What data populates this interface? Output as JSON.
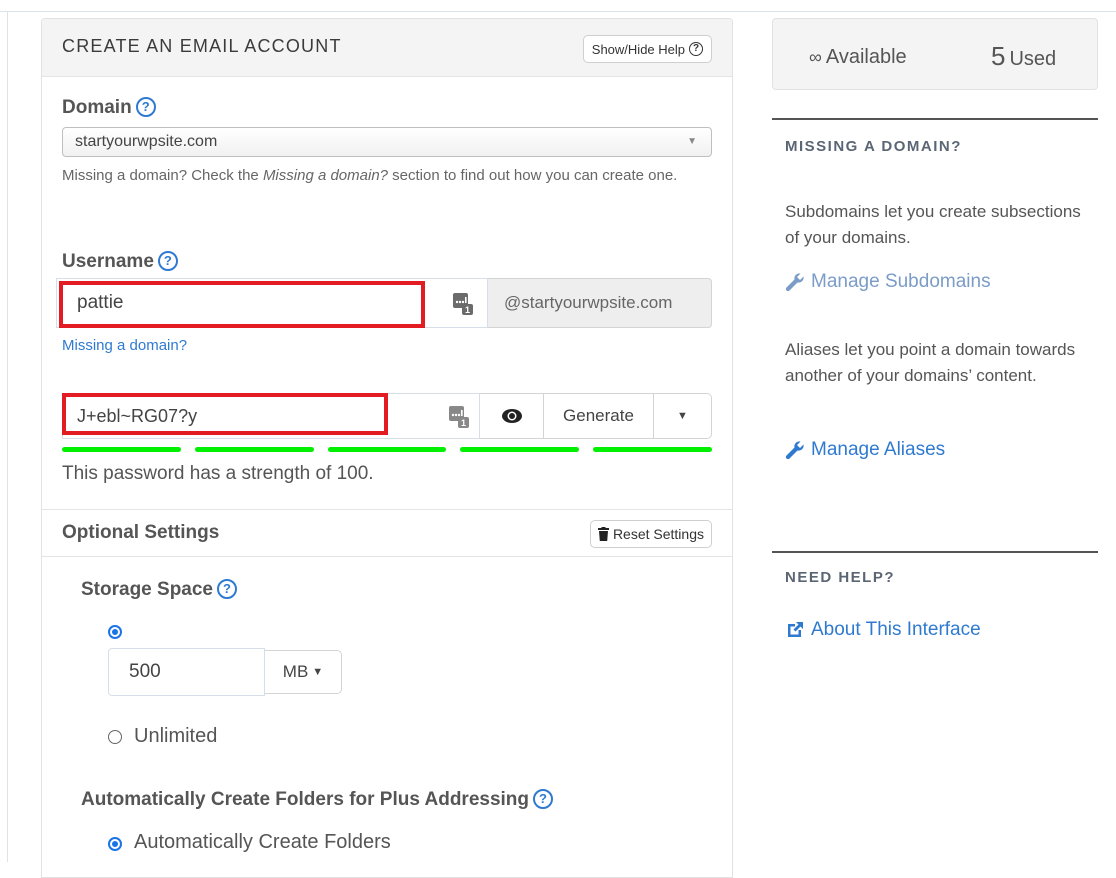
{
  "panel": {
    "title": "CREATE AN EMAIL ACCOUNT",
    "help_button": "Show/Hide Help"
  },
  "domain": {
    "label": "Domain",
    "selected": "startyourwpsite.com",
    "help_prefix": "Missing a domain? Check the ",
    "help_emphasis": "Missing a domain?",
    "help_suffix": " section to find out how you can create one."
  },
  "username": {
    "label": "Username",
    "value": "pattie",
    "suffix": "@startyourwpsite.com",
    "missing_link": "Missing a domain?"
  },
  "password": {
    "value": "J+ebl~RG07?y",
    "generate_label": "Generate",
    "strength_segments": 5,
    "strength_filled": 5,
    "strength_color": "#00f000",
    "strength_text": "This password has a strength of 100."
  },
  "optional": {
    "title": "Optional Settings",
    "reset_label": "Reset Settings",
    "storage": {
      "label": "Storage Space",
      "value": "500",
      "unit": "MB",
      "unlimited_label": "Unlimited",
      "selected": "custom"
    },
    "plus_addressing": {
      "label": "Automatically Create Folders for Plus Addressing",
      "option_label": "Automatically Create Folders",
      "selected": true
    }
  },
  "sidebar": {
    "available_symbol": "∞",
    "available_label": "Available",
    "used_count": "5",
    "used_label": "Used",
    "missing_domain": {
      "heading": "MISSING A DOMAIN?",
      "subdomains_text": "Subdomains let you create subsections of your domains.",
      "subdomains_link": "Manage Subdomains",
      "aliases_text": "Aliases let you point a domain towards another of your domains’ content.",
      "aliases_link": "Manage Aliases"
    },
    "need_help": {
      "heading": "NEED HELP?",
      "link": "About This Interface"
    }
  },
  "colors": {
    "link": "#2f7ad1",
    "link_muted": "#7a9cc6",
    "highlight": "#e31b23",
    "radio_selected": "#1a73e8"
  }
}
